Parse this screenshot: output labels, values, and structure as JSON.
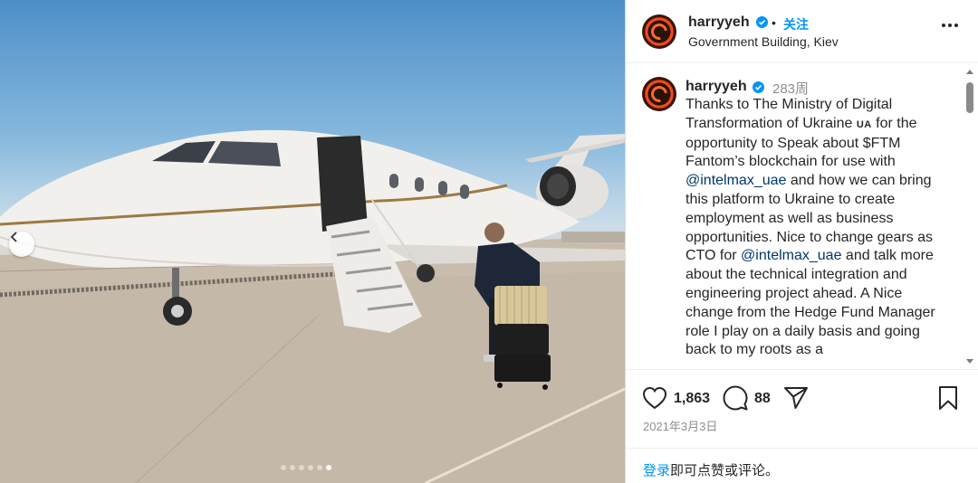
{
  "post": {
    "username": "harryyeh",
    "follow_label": "关注",
    "location": "Government Building, Kiev",
    "separator": "•"
  },
  "caption": {
    "username": "harryyeh",
    "age": "283周",
    "text_1": "Thanks to The Ministry of Digital Transformation of Ukraine ",
    "ua_label": "UA",
    "text_2": " for the opportunity to Speak about $FTM Fantom’s blockchain for use with ",
    "mention_1": "@intelmax_uae",
    "text_3": " and how we can bring this platform to Ukraine to create employment as well as business opportunities. Nice to change gears as CTO for ",
    "mention_2": "@intelmax_uae",
    "text_4": " and talk more about the technical integration and engineering project ahead. A Nice change from the Hedge Fund Manager role I play on a daily basis and going back to my roots as a"
  },
  "stats": {
    "likes": "1,863",
    "comments": "88"
  },
  "date": "2021年3月3日",
  "login": {
    "link": "登录",
    "text": "即可点赞或评论。"
  },
  "carousel": {
    "total": 6,
    "active": 6
  },
  "colors": {
    "link": "#0095f6",
    "mention": "#00376b",
    "muted": "#8e8e8e"
  },
  "icons": [
    "chevron-left-icon",
    "verified-badge-icon",
    "more-options-icon",
    "heart-icon",
    "comment-icon",
    "share-icon",
    "bookmark-icon"
  ]
}
